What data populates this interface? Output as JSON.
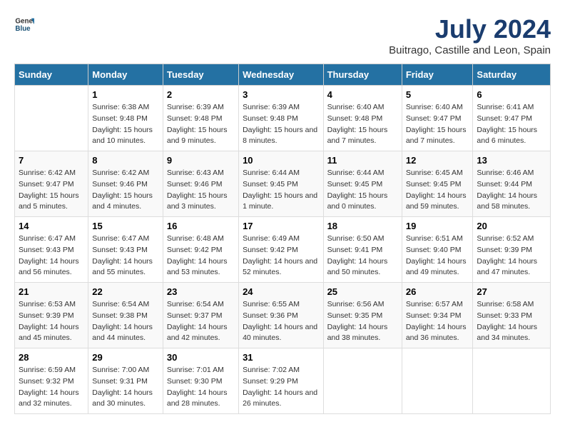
{
  "header": {
    "logo_general": "General",
    "logo_blue": "Blue",
    "month_year": "July 2024",
    "location": "Buitrago, Castille and Leon, Spain"
  },
  "weekdays": [
    "Sunday",
    "Monday",
    "Tuesday",
    "Wednesday",
    "Thursday",
    "Friday",
    "Saturday"
  ],
  "weeks": [
    [
      {
        "day": null,
        "info": null
      },
      {
        "day": "1",
        "sunrise": "6:38 AM",
        "sunset": "9:48 PM",
        "daylight": "15 hours and 10 minutes."
      },
      {
        "day": "2",
        "sunrise": "6:39 AM",
        "sunset": "9:48 PM",
        "daylight": "15 hours and 9 minutes."
      },
      {
        "day": "3",
        "sunrise": "6:39 AM",
        "sunset": "9:48 PM",
        "daylight": "15 hours and 8 minutes."
      },
      {
        "day": "4",
        "sunrise": "6:40 AM",
        "sunset": "9:48 PM",
        "daylight": "15 hours and 7 minutes."
      },
      {
        "day": "5",
        "sunrise": "6:40 AM",
        "sunset": "9:47 PM",
        "daylight": "15 hours and 7 minutes."
      },
      {
        "day": "6",
        "sunrise": "6:41 AM",
        "sunset": "9:47 PM",
        "daylight": "15 hours and 6 minutes."
      }
    ],
    [
      {
        "day": "7",
        "sunrise": "6:42 AM",
        "sunset": "9:47 PM",
        "daylight": "15 hours and 5 minutes."
      },
      {
        "day": "8",
        "sunrise": "6:42 AM",
        "sunset": "9:46 PM",
        "daylight": "15 hours and 4 minutes."
      },
      {
        "day": "9",
        "sunrise": "6:43 AM",
        "sunset": "9:46 PM",
        "daylight": "15 hours and 3 minutes."
      },
      {
        "day": "10",
        "sunrise": "6:44 AM",
        "sunset": "9:45 PM",
        "daylight": "15 hours and 1 minute."
      },
      {
        "day": "11",
        "sunrise": "6:44 AM",
        "sunset": "9:45 PM",
        "daylight": "15 hours and 0 minutes."
      },
      {
        "day": "12",
        "sunrise": "6:45 AM",
        "sunset": "9:45 PM",
        "daylight": "14 hours and 59 minutes."
      },
      {
        "day": "13",
        "sunrise": "6:46 AM",
        "sunset": "9:44 PM",
        "daylight": "14 hours and 58 minutes."
      }
    ],
    [
      {
        "day": "14",
        "sunrise": "6:47 AM",
        "sunset": "9:43 PM",
        "daylight": "14 hours and 56 minutes."
      },
      {
        "day": "15",
        "sunrise": "6:47 AM",
        "sunset": "9:43 PM",
        "daylight": "14 hours and 55 minutes."
      },
      {
        "day": "16",
        "sunrise": "6:48 AM",
        "sunset": "9:42 PM",
        "daylight": "14 hours and 53 minutes."
      },
      {
        "day": "17",
        "sunrise": "6:49 AM",
        "sunset": "9:42 PM",
        "daylight": "14 hours and 52 minutes."
      },
      {
        "day": "18",
        "sunrise": "6:50 AM",
        "sunset": "9:41 PM",
        "daylight": "14 hours and 50 minutes."
      },
      {
        "day": "19",
        "sunrise": "6:51 AM",
        "sunset": "9:40 PM",
        "daylight": "14 hours and 49 minutes."
      },
      {
        "day": "20",
        "sunrise": "6:52 AM",
        "sunset": "9:39 PM",
        "daylight": "14 hours and 47 minutes."
      }
    ],
    [
      {
        "day": "21",
        "sunrise": "6:53 AM",
        "sunset": "9:39 PM",
        "daylight": "14 hours and 45 minutes."
      },
      {
        "day": "22",
        "sunrise": "6:54 AM",
        "sunset": "9:38 PM",
        "daylight": "14 hours and 44 minutes."
      },
      {
        "day": "23",
        "sunrise": "6:54 AM",
        "sunset": "9:37 PM",
        "daylight": "14 hours and 42 minutes."
      },
      {
        "day": "24",
        "sunrise": "6:55 AM",
        "sunset": "9:36 PM",
        "daylight": "14 hours and 40 minutes."
      },
      {
        "day": "25",
        "sunrise": "6:56 AM",
        "sunset": "9:35 PM",
        "daylight": "14 hours and 38 minutes."
      },
      {
        "day": "26",
        "sunrise": "6:57 AM",
        "sunset": "9:34 PM",
        "daylight": "14 hours and 36 minutes."
      },
      {
        "day": "27",
        "sunrise": "6:58 AM",
        "sunset": "9:33 PM",
        "daylight": "14 hours and 34 minutes."
      }
    ],
    [
      {
        "day": "28",
        "sunrise": "6:59 AM",
        "sunset": "9:32 PM",
        "daylight": "14 hours and 32 minutes."
      },
      {
        "day": "29",
        "sunrise": "7:00 AM",
        "sunset": "9:31 PM",
        "daylight": "14 hours and 30 minutes."
      },
      {
        "day": "30",
        "sunrise": "7:01 AM",
        "sunset": "9:30 PM",
        "daylight": "14 hours and 28 minutes."
      },
      {
        "day": "31",
        "sunrise": "7:02 AM",
        "sunset": "9:29 PM",
        "daylight": "14 hours and 26 minutes."
      },
      {
        "day": null,
        "info": null
      },
      {
        "day": null,
        "info": null
      },
      {
        "day": null,
        "info": null
      }
    ]
  ]
}
